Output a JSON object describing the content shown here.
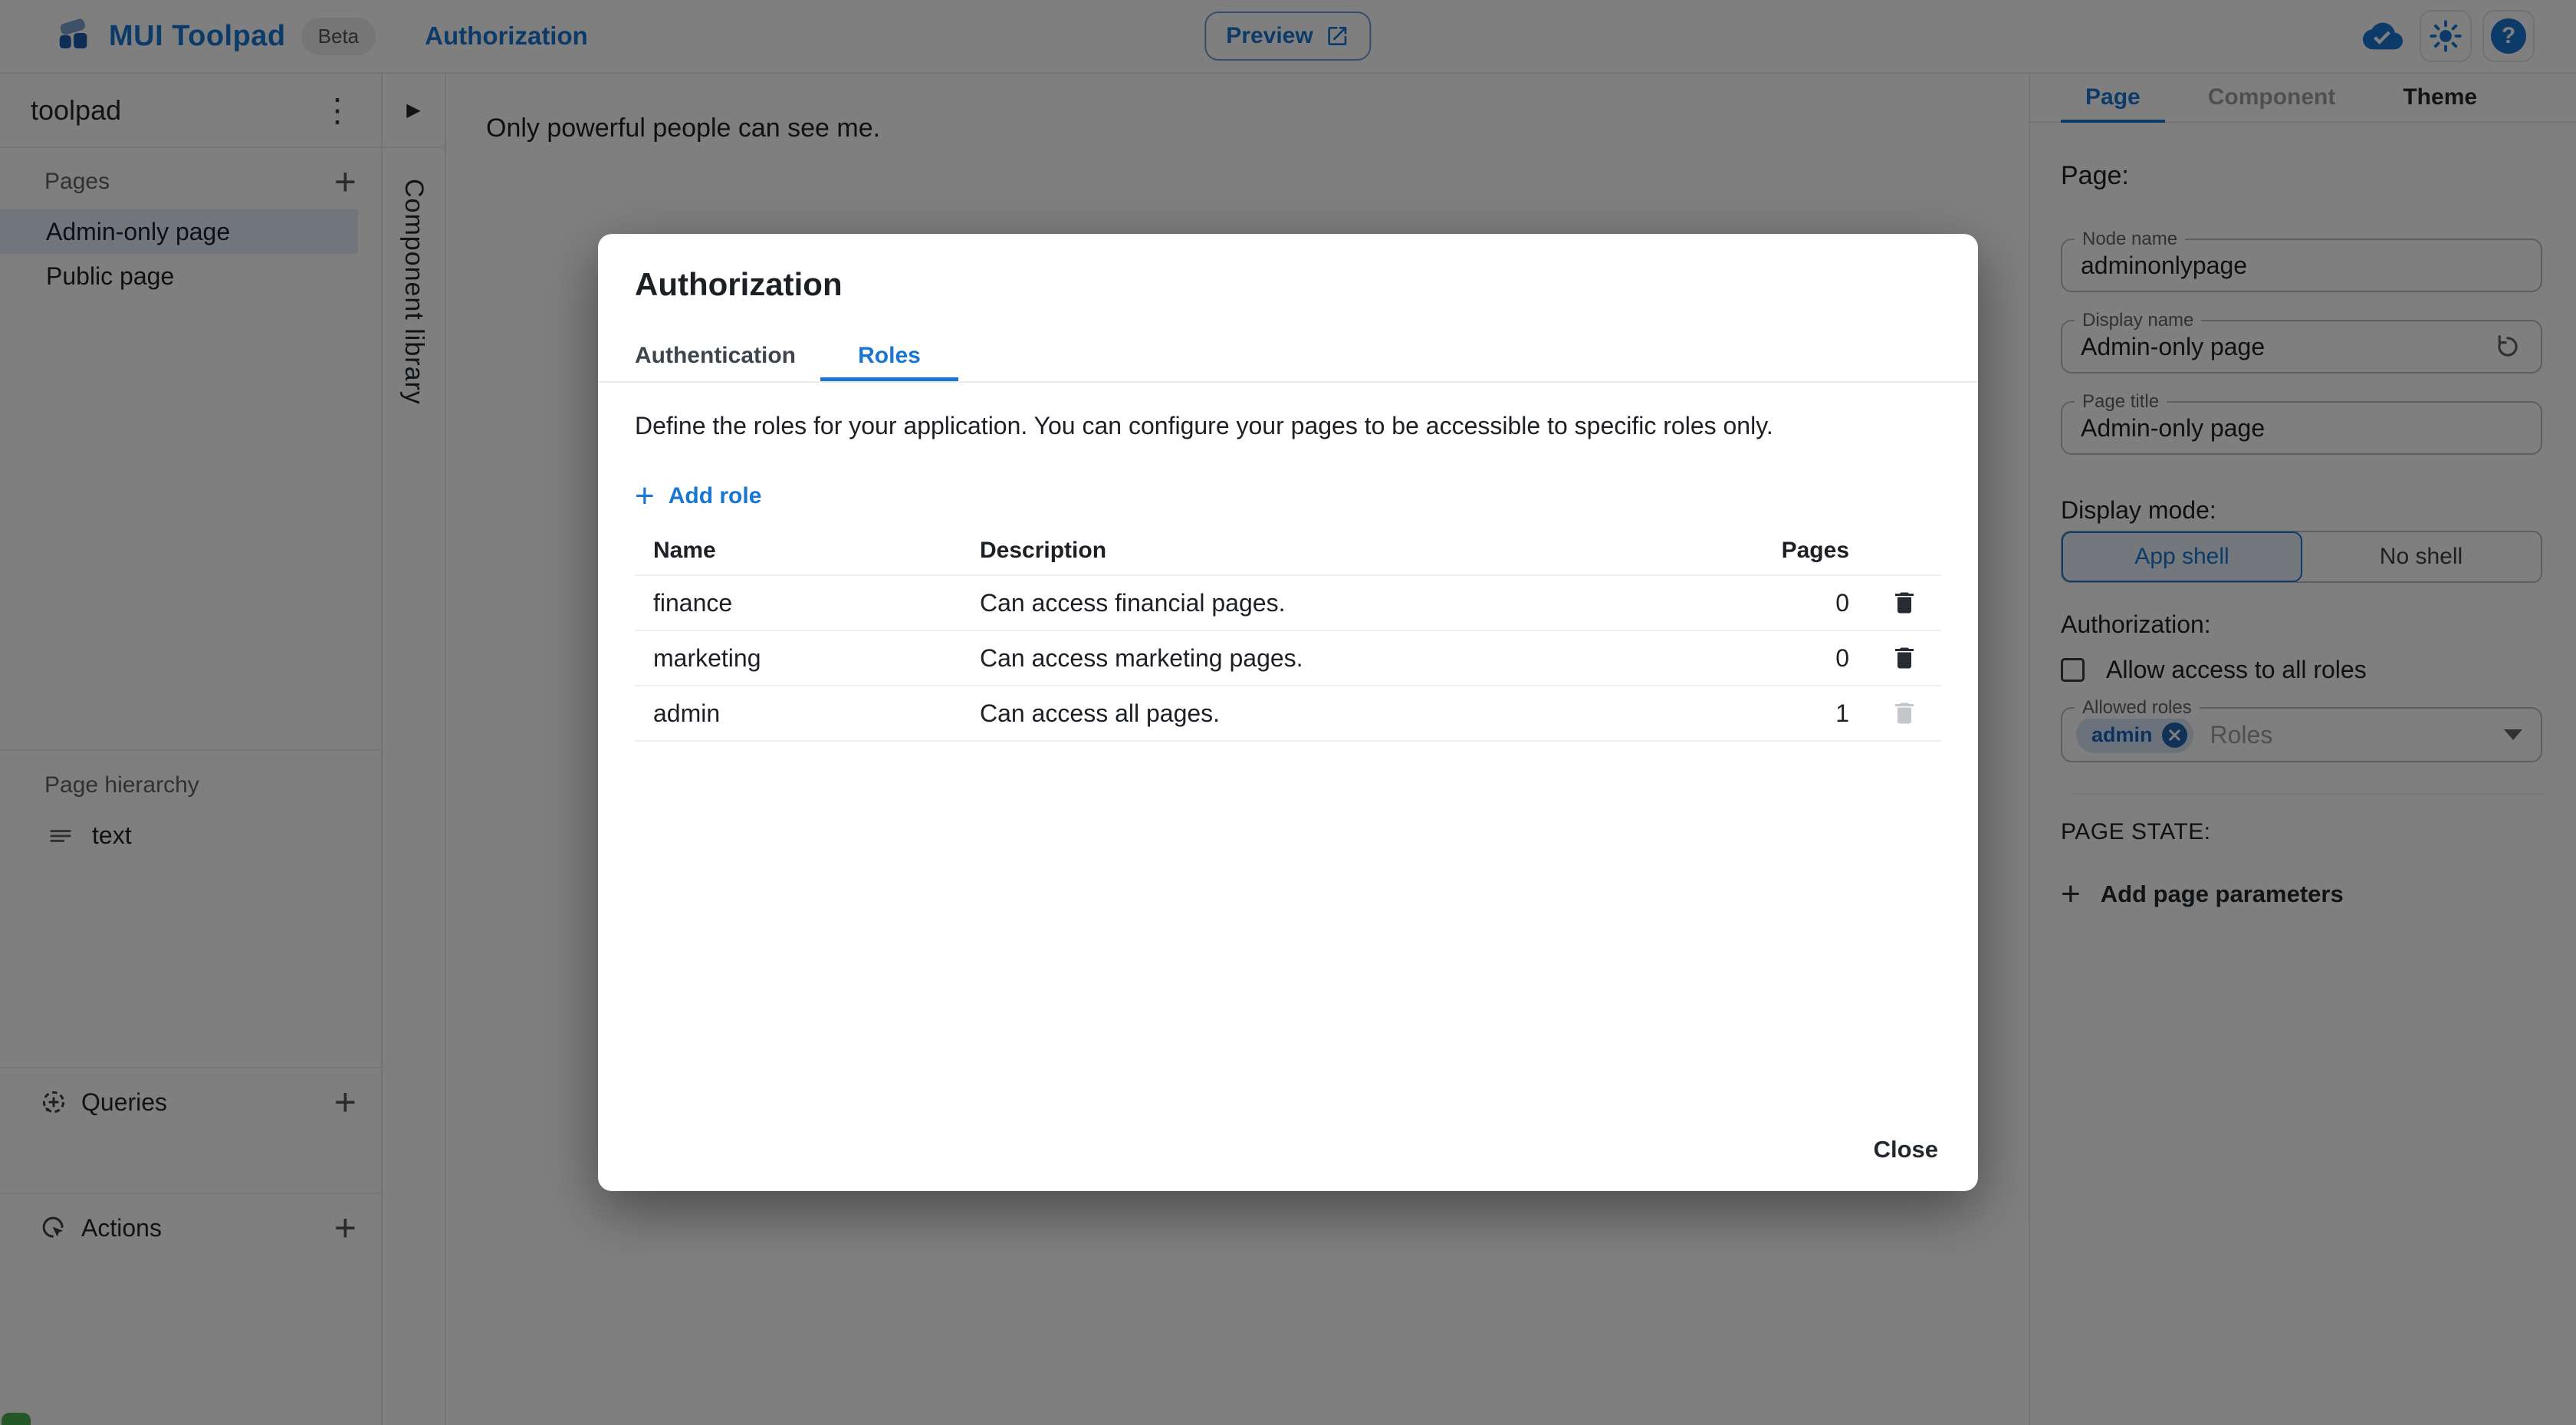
{
  "colors": {
    "primary": "#1976d2",
    "selected_nav_bg": "#e3ecf8",
    "chip_bg": "#d7e5f8",
    "backdrop": "rgba(0,0,0,0.5)"
  },
  "header": {
    "app_name": "MUI Toolpad",
    "beta_badge": "Beta",
    "breadcrumb": "Authorization",
    "preview_label": "Preview"
  },
  "sidebar": {
    "project_name": "toolpad",
    "pages_section_label": "Pages",
    "pages": [
      {
        "label": "Admin-only page"
      },
      {
        "label": "Public page"
      }
    ],
    "hierarchy_section_label": "Page hierarchy",
    "hierarchy_items": [
      {
        "label": "text"
      }
    ],
    "queries_section_label": "Queries",
    "actions_section_label": "Actions"
  },
  "component_library": {
    "label": "Component library"
  },
  "canvas": {
    "text": "Only powerful people can see me."
  },
  "dialog": {
    "title": "Authorization",
    "tabs": [
      {
        "label": "Authentication"
      },
      {
        "label": "Roles"
      }
    ],
    "description": "Define the roles for your application. You can configure your pages to be accessible to specific roles only.",
    "add_role_label": "Add role",
    "table": {
      "headers": {
        "name": "Name",
        "description": "Description",
        "pages": "Pages"
      },
      "rows": [
        {
          "name": "finance",
          "description": "Can access financial pages.",
          "pages": "0"
        },
        {
          "name": "marketing",
          "description": "Can access marketing pages.",
          "pages": "0"
        },
        {
          "name": "admin",
          "description": "Can access all pages.",
          "pages": "1"
        }
      ]
    },
    "close_label": "Close"
  },
  "inspector": {
    "tabs": [
      {
        "label": "Page"
      },
      {
        "label": "Component"
      },
      {
        "label": "Theme"
      }
    ],
    "section_title": "Page:",
    "fields": [
      {
        "label": "Node name",
        "value": "adminonlypage"
      },
      {
        "label": "Display name",
        "value": "Admin-only page"
      },
      {
        "label": "Page title",
        "value": "Admin-only page"
      }
    ],
    "display_mode": {
      "label": "Display mode:",
      "options": [
        {
          "label": "App shell"
        },
        {
          "label": "No shell"
        }
      ]
    },
    "authorization": {
      "label": "Authorization:",
      "checkbox_label": "Allow access to all roles",
      "allowed_roles_label": "Allowed roles",
      "chip": "admin",
      "placeholder": "Roles"
    },
    "page_state": {
      "label": "PAGE STATE:",
      "add_params_label": "Add page parameters"
    }
  }
}
